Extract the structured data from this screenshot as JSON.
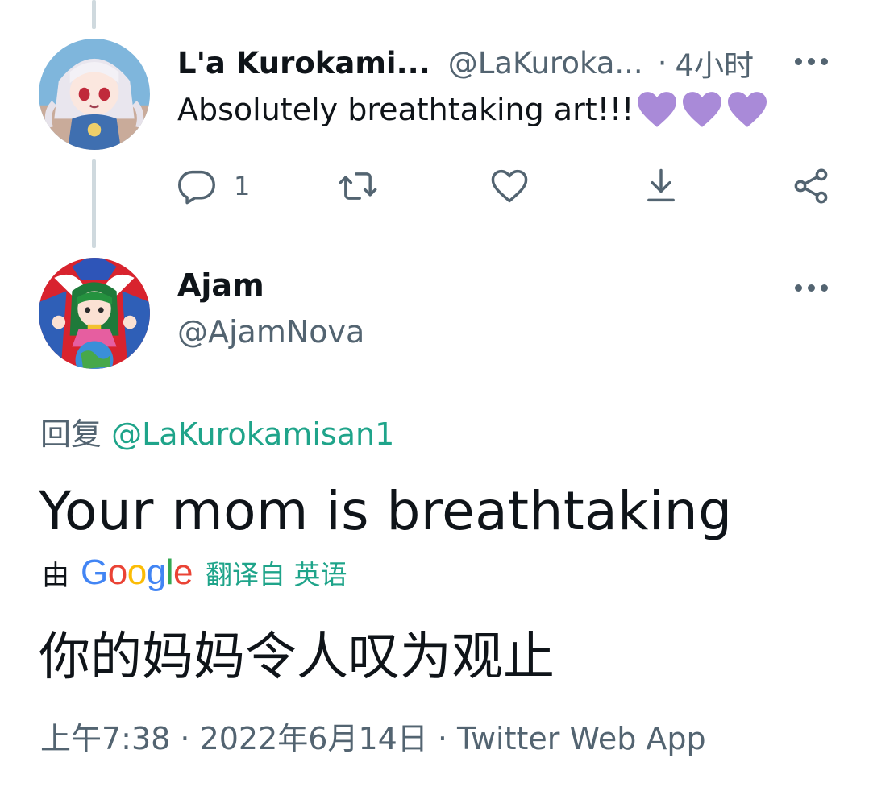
{
  "reply": {
    "display_name": "L'a Kurokami...",
    "handle": "@LaKuroka...",
    "separator": "·",
    "time": "4小时",
    "text": "Absolutely breathtaking art!!!",
    "reply_count": "1"
  },
  "tweet": {
    "display_name": "Ajam",
    "handle": "@AjamNova",
    "replying_label": "回复",
    "replying_to": "@LaKurokamisan1",
    "text": "Your mom is breathtaking",
    "translated_by_label": "由",
    "translated_from_label": "翻译自 英语",
    "translated_text": "你的妈妈令人叹为观止",
    "timestamp": "上午7:38 · 2022年6月14日 · Twitter Web App"
  },
  "colors": {
    "text_primary": "#0f1419",
    "text_secondary": "#536471",
    "mention": "#1fa48a",
    "heart_emoji": "#a98ad8",
    "thread_line": "#cfd9de"
  },
  "icons": [
    "reply-icon",
    "retweet-icon",
    "like-icon",
    "download-icon",
    "share-icon",
    "more-icon",
    "purple-heart-icon",
    "google-logo"
  ]
}
